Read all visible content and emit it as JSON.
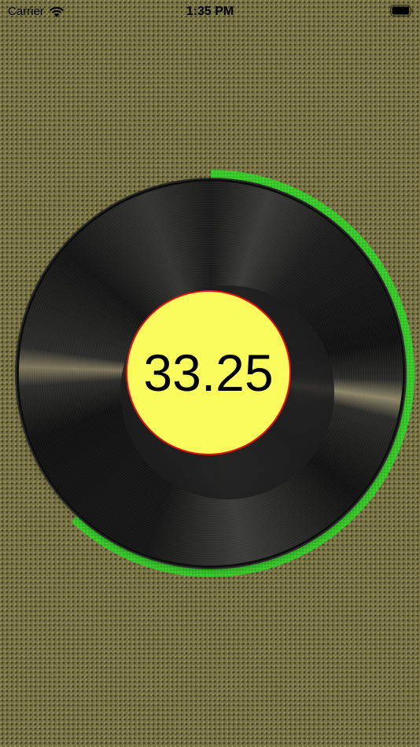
{
  "status_bar": {
    "carrier": "Carrier",
    "time": "1:35 PM",
    "wifi_icon": "wifi-icon",
    "battery_icon": "battery-icon"
  },
  "turntable": {
    "speed_value": "33.25",
    "progress_fraction": 0.62,
    "colors": {
      "progress": "#38c92a",
      "label_fill": "#fafb5c",
      "label_border": "#e0120e",
      "background": "#7a7445"
    }
  }
}
